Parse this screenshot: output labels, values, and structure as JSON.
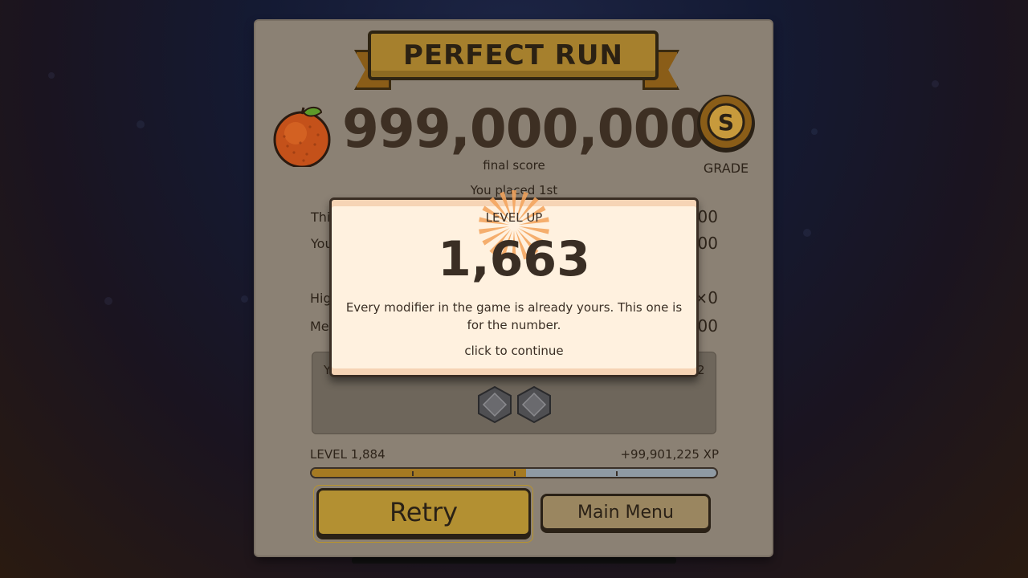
{
  "banner": {
    "title": "PERFECT RUN"
  },
  "score": {
    "value": "999,000,000",
    "label": "final score"
  },
  "grade": {
    "letter": "S",
    "label": "GRADE"
  },
  "placement": "You placed 1st",
  "stats": [
    {
      "label_fragment": "Thi",
      "value_fragment": "00"
    },
    {
      "label_fragment": "You",
      "value_fragment": "00"
    },
    {
      "label_fragment": "Hig",
      "value_fragment": "×0"
    },
    {
      "label_fragment": "Mer",
      "value_fragment": "00"
    }
  ],
  "modifiers": {
    "header_left": "Y",
    "header_right": "2",
    "chips": [
      {
        "name": "modifier-chip-1",
        "icon": "hexagon-badge"
      },
      {
        "name": "modifier-chip-2",
        "icon": "hexagon-badge"
      }
    ]
  },
  "progress": {
    "level_label": "LEVEL 1,884",
    "xp_label": "+99,901,225 XP",
    "fill_fraction": 0.53
  },
  "buttons": {
    "retry": "Retry",
    "main_menu": "Main Menu"
  },
  "level_up": {
    "title": "LEVEL UP",
    "level": "1,663",
    "message": "Every modifier in the game is already yours. This one is for the number.",
    "continue": "click to continue"
  },
  "colors": {
    "panel": "#8b8174",
    "gold": "#a6802d",
    "modal_bg": "#fff1df",
    "text_dark": "#2e241a",
    "xp_fill": "#a57a22"
  }
}
